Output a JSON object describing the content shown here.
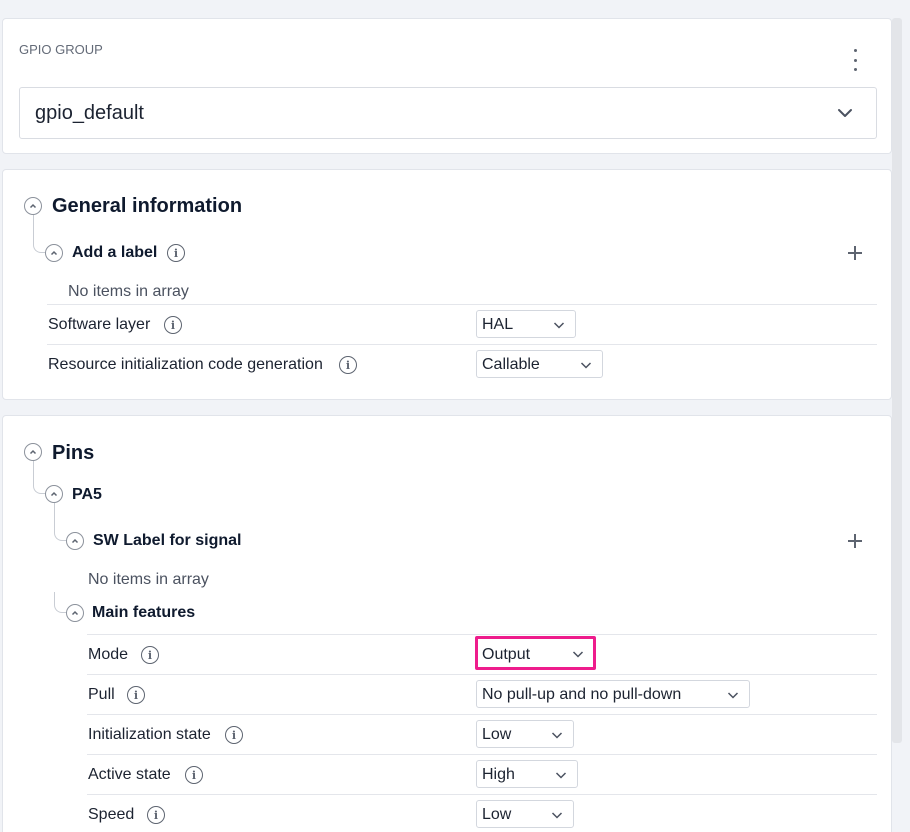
{
  "gpio_group": {
    "label": "GPIO GROUP",
    "selected": "gpio_default",
    "menu_icon": "kebab-vertical-icon"
  },
  "general_information": {
    "title": "General information",
    "add_label": {
      "title": "Add a label",
      "empty_text": "No items in array"
    },
    "rows": [
      {
        "label": "Software layer",
        "value": "HAL"
      },
      {
        "label": "Resource initialization code generation",
        "value": "Callable"
      }
    ]
  },
  "pins": {
    "title": "Pins",
    "pin": {
      "name": "PA5",
      "sw_label": {
        "title": "SW Label for signal",
        "empty_text": "No items in array"
      },
      "main_features": {
        "title": "Main features",
        "rows": [
          {
            "label": "Mode",
            "value": "Output"
          },
          {
            "label": "Pull",
            "value": "No pull-up and no pull-down"
          },
          {
            "label": "Initialization state",
            "value": "Low"
          },
          {
            "label": "Active state",
            "value": "High"
          },
          {
            "label": "Speed",
            "value": "Low"
          }
        ]
      }
    }
  },
  "colors": {
    "highlight": "#ee1c8c",
    "heading": "#0f1a2e",
    "background": "#f1f3f7"
  }
}
